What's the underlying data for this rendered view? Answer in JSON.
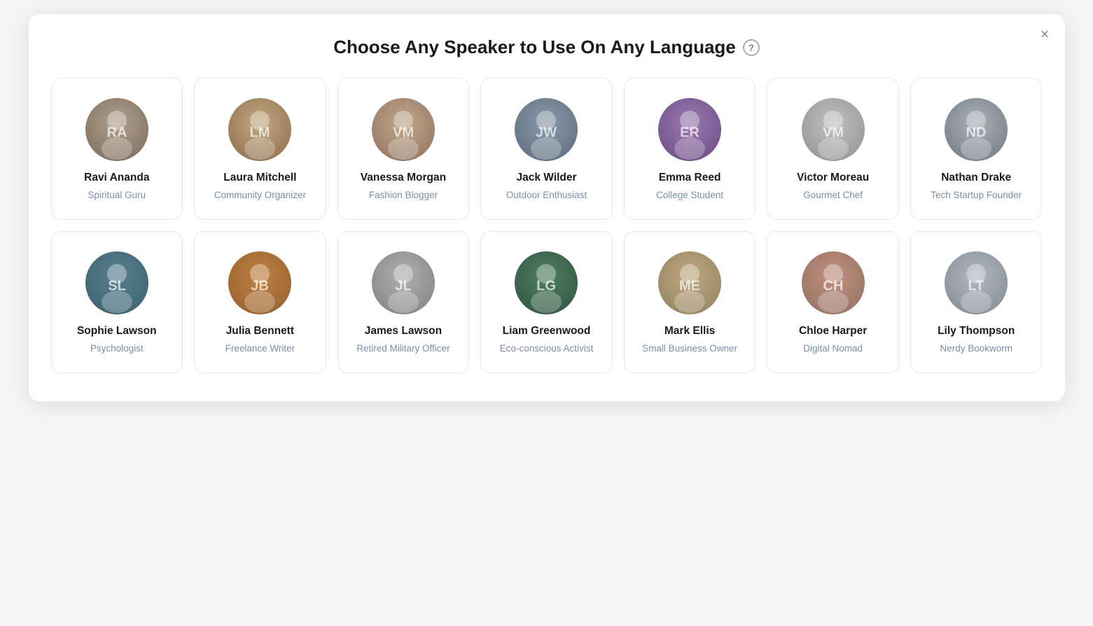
{
  "modal": {
    "title": "Choose Any Speaker to Use On Any Language",
    "help_icon_label": "?",
    "close_label": "×"
  },
  "speakers": [
    {
      "id": "ravi",
      "name": "Ravi Ananda",
      "role": "Spiritual Guru",
      "avatar_class": "av-ravi",
      "avatar_initials": "RA"
    },
    {
      "id": "laura",
      "name": "Laura Mitchell",
      "role": "Community Organizer",
      "avatar_class": "av-laura",
      "avatar_initials": "LM"
    },
    {
      "id": "vanessa",
      "name": "Vanessa Morgan",
      "role": "Fashion Blogger",
      "avatar_class": "av-vanessa",
      "avatar_initials": "VM"
    },
    {
      "id": "jack",
      "name": "Jack Wilder",
      "role": "Outdoor Enthusiast",
      "avatar_class": "av-jack",
      "avatar_initials": "JW"
    },
    {
      "id": "emma",
      "name": "Emma Reed",
      "role": "College Student",
      "avatar_class": "av-emma",
      "avatar_initials": "ER"
    },
    {
      "id": "victor",
      "name": "Victor Moreau",
      "role": "Gourmet Chef",
      "avatar_class": "av-victor",
      "avatar_initials": "VM"
    },
    {
      "id": "nathan",
      "name": "Nathan Drake",
      "role": "Tech Startup Founder",
      "avatar_class": "av-nathan",
      "avatar_initials": "ND"
    },
    {
      "id": "sophie",
      "name": "Sophie Lawson",
      "role": "Psychologist",
      "avatar_class": "av-sophie",
      "avatar_initials": "SL"
    },
    {
      "id": "julia",
      "name": "Julia Bennett",
      "role": "Freelance Writer",
      "avatar_class": "av-julia",
      "avatar_initials": "JB"
    },
    {
      "id": "james",
      "name": "James Lawson",
      "role": "Retired Military Officer",
      "avatar_class": "av-james",
      "avatar_initials": "JL"
    },
    {
      "id": "liam",
      "name": "Liam Greenwood",
      "role": "Eco-conscious Activist",
      "avatar_class": "av-liam",
      "avatar_initials": "LG"
    },
    {
      "id": "mark",
      "name": "Mark Ellis",
      "role": "Small Business Owner",
      "avatar_class": "av-mark",
      "avatar_initials": "ME"
    },
    {
      "id": "chloe",
      "name": "Chloe Harper",
      "role": "Digital Nomad",
      "avatar_class": "av-chloe",
      "avatar_initials": "CH"
    },
    {
      "id": "lily",
      "name": "Lily Thompson",
      "role": "Nerdy Bookworm",
      "avatar_class": "av-lily",
      "avatar_initials": "LT"
    }
  ]
}
